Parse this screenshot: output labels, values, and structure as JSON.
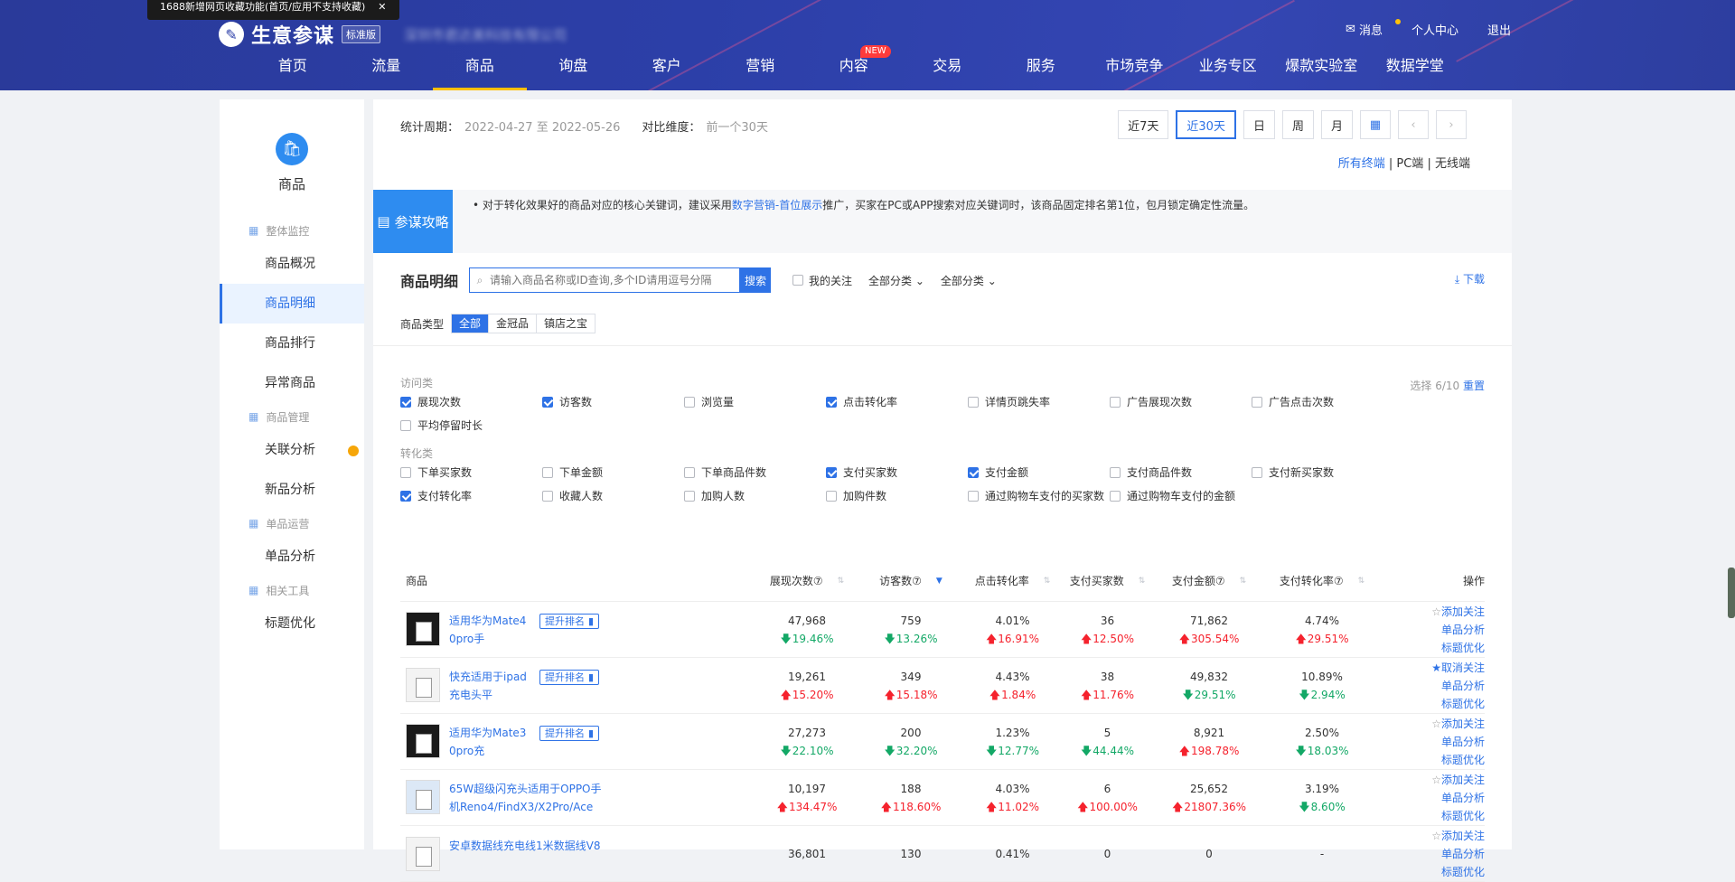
{
  "notice": {
    "text": "1688新增网页收藏功能(首页/应用不支持收藏)",
    "close": "✕"
  },
  "brand": {
    "logo_icon": "pen-icon",
    "name": "生意参谋",
    "edition": "标准版",
    "company": "深圳市君达美科技有限公司"
  },
  "user": {
    "messages": "消息",
    "center": "个人中心",
    "logout": "退出"
  },
  "nav": [
    {
      "label": "首页"
    },
    {
      "label": "流量"
    },
    {
      "label": "商品",
      "active": true
    },
    {
      "label": "询盘"
    },
    {
      "label": "客户"
    },
    {
      "label": "营销"
    },
    {
      "label": "内容",
      "badge": "NEW"
    },
    {
      "label": "交易"
    },
    {
      "label": "服务"
    },
    {
      "label": "市场竞争"
    },
    {
      "label": "业务专区"
    },
    {
      "label": "爆款实验室"
    },
    {
      "label": "数据学堂"
    }
  ],
  "sidebar": {
    "title": "商品",
    "groups": [
      {
        "label": "整体监控",
        "items": [
          "商品概况",
          "商品明细",
          "商品排行",
          "异常商品"
        ]
      },
      {
        "label": "商品管理",
        "items": [
          "关联分析",
          "新品分析"
        ]
      },
      {
        "label": "单品运营",
        "items": [
          "单品分析"
        ]
      },
      {
        "label": "相关工具",
        "items": [
          "标题优化"
        ]
      }
    ],
    "active": "商品明细"
  },
  "period": {
    "label": "统计周期：",
    "value": "2022-04-27 至 2022-05-26",
    "compare_label": "对比维度：",
    "compare_value": "前一个30天"
  },
  "ranges": [
    "近7天",
    "近30天",
    "日",
    "周",
    "月"
  ],
  "terminals": {
    "all": "所有终端",
    "pc": "PC端",
    "wireless": "无线端",
    "sep": "|"
  },
  "tips": {
    "tag": "参谋攻略",
    "text1": "• 对于转化效果好的商品对应的核心关键词，建议采用",
    "link": "数字营销-首位展示",
    "text2": "推广，买家在PC或APP搜索对应关键词时，该商品固定排名第1位，包月锁定确定性流量。"
  },
  "detail": {
    "title": "商品明细",
    "search_placeholder": "请输入商品名称或ID查询,多个ID请用逗号分隔",
    "search_btn": "搜索",
    "my_follow": "我的关注",
    "cat1": "全部分类",
    "cat2": "全部分类",
    "download": "下载"
  },
  "product_type": {
    "label": "商品类型",
    "options": [
      "全部",
      "金冠品",
      "镇店之宝"
    ],
    "active": "全部"
  },
  "metrics": {
    "select_info": "选择 6/10",
    "reset": "重置",
    "visit": {
      "title": "访问类",
      "items": [
        {
          "label": "展现次数",
          "on": true
        },
        {
          "label": "访客数",
          "on": true
        },
        {
          "label": "浏览量",
          "on": false
        },
        {
          "label": "点击转化率",
          "on": true
        },
        {
          "label": "详情页跳失率",
          "on": false
        },
        {
          "label": "广告展现次数",
          "on": false
        },
        {
          "label": "广告点击次数",
          "on": false
        },
        {
          "label": "平均停留时长",
          "on": false
        }
      ]
    },
    "convert": {
      "title": "转化类",
      "items": [
        {
          "label": "下单买家数",
          "on": false
        },
        {
          "label": "下单金额",
          "on": false
        },
        {
          "label": "下单商品件数",
          "on": false
        },
        {
          "label": "支付买家数",
          "on": true
        },
        {
          "label": "支付金额",
          "on": true
        },
        {
          "label": "支付商品件数",
          "on": false
        },
        {
          "label": "支付新买家数",
          "on": false
        },
        {
          "label": "支付转化率",
          "on": true
        },
        {
          "label": "收藏人数",
          "on": false
        },
        {
          "label": "加购人数",
          "on": false
        },
        {
          "label": "加购件数",
          "on": false
        },
        {
          "label": "通过购物车支付的买家数",
          "on": false
        },
        {
          "label": "通过购物车支付的金额",
          "on": false
        }
      ]
    }
  },
  "table": {
    "headers": [
      "商品",
      "展现次数⑦",
      "访客数⑦",
      "点击转化率",
      "支付买家数",
      "支付金额⑦",
      "支付转化率⑦",
      "操作"
    ],
    "boost_label": "提升排名",
    "rows": [
      {
        "name": "适用华为Mate40pro手",
        "thumb": "dark",
        "vals": [
          "47,968",
          "759",
          "4.01%",
          "36",
          "71,862",
          "4.74%"
        ],
        "chg": [
          [
            "19.46%",
            "dn"
          ],
          [
            "13.26%",
            "dn"
          ],
          [
            "16.91%",
            "up"
          ],
          [
            "12.50%",
            "up"
          ],
          [
            "305.54%",
            "up"
          ],
          [
            "29.51%",
            "up"
          ]
        ],
        "fav": "添加关注",
        "fav_on": false
      },
      {
        "name": "快充适用于ipad充电头平",
        "thumb": "light",
        "vals": [
          "19,261",
          "349",
          "4.43%",
          "38",
          "49,832",
          "10.89%"
        ],
        "chg": [
          [
            "15.20%",
            "up"
          ],
          [
            "15.18%",
            "up"
          ],
          [
            "1.84%",
            "up"
          ],
          [
            "11.76%",
            "up"
          ],
          [
            "29.51%",
            "dn"
          ],
          [
            "2.94%",
            "dn"
          ]
        ],
        "fav": "取消关注",
        "fav_on": true
      },
      {
        "name": "适用华为Mate30pro充",
        "thumb": "dark",
        "vals": [
          "27,273",
          "200",
          "1.23%",
          "5",
          "8,921",
          "2.50%"
        ],
        "chg": [
          [
            "22.10%",
            "dn"
          ],
          [
            "32.20%",
            "dn"
          ],
          [
            "12.77%",
            "dn"
          ],
          [
            "44.44%",
            "dn"
          ],
          [
            "198.78%",
            "up"
          ],
          [
            "18.03%",
            "dn"
          ]
        ],
        "fav": "添加关注",
        "fav_on": false
      },
      {
        "name": "65W超级闪充头适用于OPPO手机Reno4/FindX3/X2Pro/Ace",
        "thumb": "blue",
        "wide": true,
        "vals": [
          "10,197",
          "188",
          "4.03%",
          "6",
          "25,652",
          "3.19%"
        ],
        "chg": [
          [
            "134.47%",
            "up"
          ],
          [
            "118.60%",
            "up"
          ],
          [
            "11.02%",
            "up"
          ],
          [
            "100.00%",
            "up"
          ],
          [
            "21807.36%",
            "up"
          ],
          [
            "8.60%",
            "dn"
          ]
        ],
        "fav": "添加关注",
        "fav_on": false
      },
      {
        "name": "安卓数据线充电线1米数据线V8",
        "thumb": "light",
        "wide": true,
        "vals": [
          "36,801",
          "130",
          "0.41%",
          "0",
          "0",
          "-"
        ],
        "chg": [],
        "fav": "添加关注",
        "fav_on": false
      }
    ],
    "op_single": "单品分析",
    "op_title": "标题优化"
  }
}
